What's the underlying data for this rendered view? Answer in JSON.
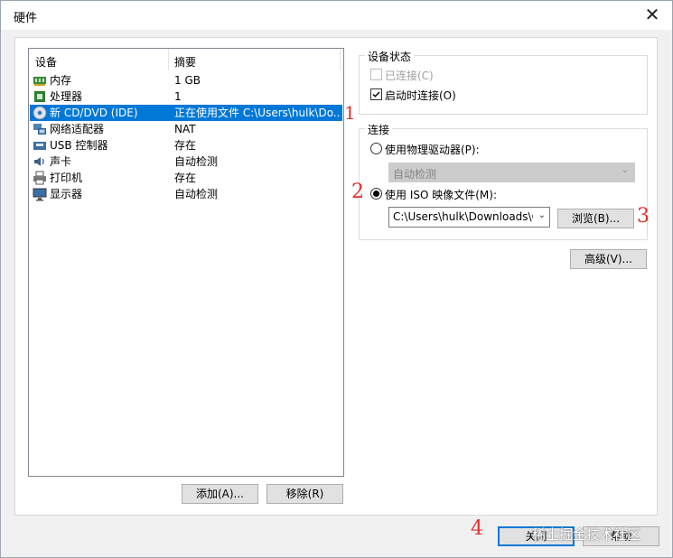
{
  "window": {
    "title": "硬件",
    "close_icon": "close-icon"
  },
  "devices": {
    "headers": {
      "device": "设备",
      "summary": "摘要"
    },
    "rows": [
      {
        "name": "内存",
        "summary": "1 GB",
        "icon": "memory-icon",
        "selected": false
      },
      {
        "name": "处理器",
        "summary": "1",
        "icon": "processor-icon",
        "selected": false
      },
      {
        "name": "新 CD/DVD (IDE)",
        "summary": "正在使用文件 C:\\Users\\hulk\\Do...",
        "icon": "cd-dvd-icon",
        "selected": true
      },
      {
        "name": "网络适配器",
        "summary": "NAT",
        "icon": "network-adapter-icon",
        "selected": false
      },
      {
        "name": "USB 控制器",
        "summary": "存在",
        "icon": "usb-icon",
        "selected": false
      },
      {
        "name": "声卡",
        "summary": "自动检测",
        "icon": "sound-card-icon",
        "selected": false
      },
      {
        "name": "打印机",
        "summary": "存在",
        "icon": "printer-icon",
        "selected": false
      },
      {
        "name": "显示器",
        "summary": "自动检测",
        "icon": "display-icon",
        "selected": false
      }
    ],
    "add_button": "添加(A)...",
    "remove_button": "移除(R)"
  },
  "device_status": {
    "title": "设备状态",
    "connected": {
      "label": "已连接(C)",
      "checked": false,
      "disabled": true
    },
    "connect_at_power_on": {
      "label": "启动时连接(O)",
      "checked": true,
      "disabled": false
    }
  },
  "connection": {
    "title": "连接",
    "physical_drive": {
      "label": "使用物理驱动器(P):",
      "selected": false
    },
    "physical_drive_value": "自动检测",
    "iso_image": {
      "label": "使用 ISO 映像文件(M):",
      "selected": true
    },
    "iso_path": "C:\\Users\\hulk\\Downloads\\Ce",
    "browse_button": "浏览(B)..."
  },
  "advanced_button": "高级(V)...",
  "footer": {
    "close_button": "关闭",
    "help_button": "帮助"
  },
  "annotations": [
    "1",
    "2",
    "3",
    "4"
  ],
  "watermark": "稀土掘金技术社区",
  "background_text": "vmware",
  "colors": {
    "selection": "#0078d7",
    "annotation": "#e0302b"
  }
}
